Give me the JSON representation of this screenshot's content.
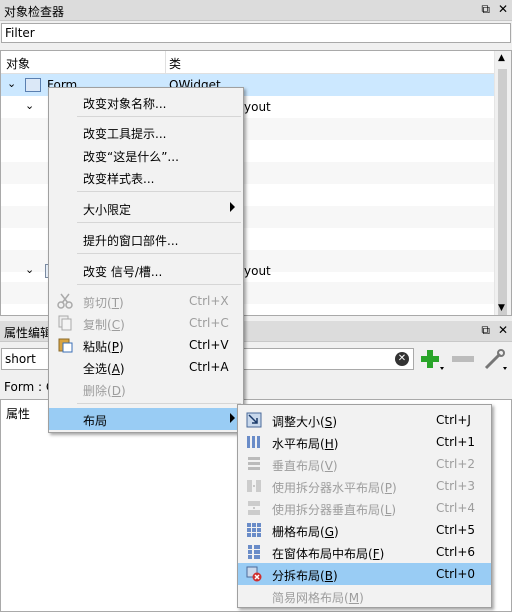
{
  "object_inspector": {
    "title": "对象检查器",
    "filter_placeholder": "Filter",
    "col_object": "对象",
    "col_class": "类",
    "rows": [
      {
        "name": "Form",
        "class": "QWidget"
      },
      {
        "class": "yout"
      },
      {
        "class": "yout"
      }
    ]
  },
  "property_editor": {
    "title": "属性编辑",
    "search_value": "short",
    "form_label": "Form : C",
    "col_property": "属性"
  },
  "context_menu": {
    "items": {
      "rename": "改变对象名称...",
      "tooltip": "改变工具提示...",
      "whatsthis": "改变“这是什么”...",
      "stylesheet": "改变样式表...",
      "size_constraints": "大小限定",
      "promoted": "提升的窗口部件...",
      "signals": "改变 信号/槽...",
      "cut": "剪切",
      "cut_key": "T",
      "cut_sc": "Ctrl+X",
      "copy": "复制",
      "copy_key": "C",
      "copy_sc": "Ctrl+C",
      "paste": "粘贴",
      "paste_key": "P",
      "paste_sc": "Ctrl+V",
      "select_all": "全选",
      "select_all_key": "A",
      "select_all_sc": "Ctrl+A",
      "delete": "删除",
      "delete_key": "D",
      "layout": "布局"
    }
  },
  "layout_submenu": {
    "adjust_size": "调整大小",
    "adjust_size_key": "S",
    "adjust_size_sc": "Ctrl+J",
    "horizontal": "水平布局",
    "horizontal_key": "H",
    "horizontal_sc": "Ctrl+1",
    "vertical": "垂直布局",
    "vertical_key": "V",
    "vertical_sc": "Ctrl+2",
    "split_h": "使用拆分器水平布局",
    "split_h_key": "P",
    "split_h_sc": "Ctrl+3",
    "split_v": "使用拆分器垂直布局",
    "split_v_key": "L",
    "split_v_sc": "Ctrl+4",
    "grid": "栅格布局",
    "grid_key": "G",
    "grid_sc": "Ctrl+5",
    "form": "在窗体布局中布局",
    "form_key": "F",
    "form_sc": "Ctrl+6",
    "break": "分拆布局",
    "break_key": "B",
    "break_sc": "Ctrl+0",
    "simple_grid": "简易网格布局",
    "simple_grid_key": "M"
  },
  "colors": {
    "highlight": "#99ccf4",
    "accent_green": "#2aa52a"
  }
}
